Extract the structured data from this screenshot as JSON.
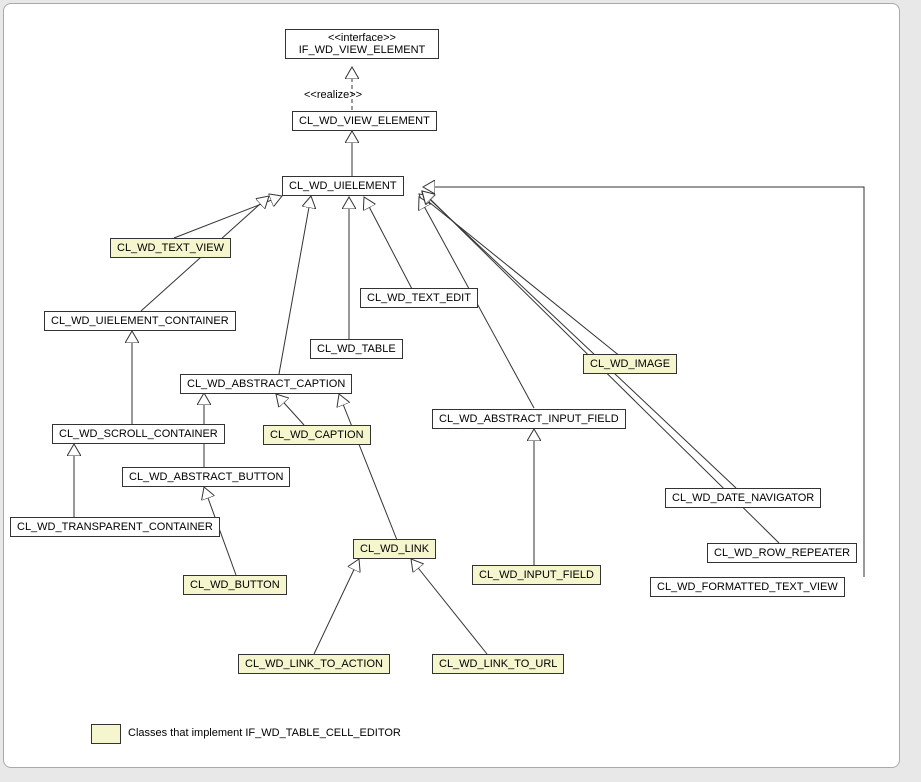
{
  "stereotypes": {
    "interface": "<<interface>>",
    "realize": "<<realize>>"
  },
  "nodes": {
    "if_view_element": "IF_WD_VIEW_ELEMENT",
    "view_element": "CL_WD_VIEW_ELEMENT",
    "uielement": "CL_WD_UIELEMENT",
    "text_view": "CL_WD_TEXT_VIEW",
    "text_edit": "CL_WD_TEXT_EDIT",
    "uielement_container": "CL_WD_UIELEMENT_CONTAINER",
    "table": "CL_WD_TABLE",
    "image": "CL_WD_IMAGE",
    "abstract_caption": "CL_WD_ABSTRACT_CAPTION",
    "abstract_input_field": "CL_WD_ABSTRACT_INPUT_FIELD",
    "scroll_container": "CL_WD_SCROLL_CONTAINER",
    "caption": "CL_WD_CAPTION",
    "date_navigator": "CL_WD_DATE_NAVIGATOR",
    "abstract_button": "CL_WD_ABSTRACT_BUTTON",
    "row_repeater": "CL_WD_ROW_REPEATER",
    "transparent_container": "CL_WD_TRANSPARENT_CONTAINER",
    "link": "CL_WD_LINK",
    "input_field": "CL_WD_INPUT_FIELD",
    "formatted_text_view": "CL_WD_FORMATTED_TEXT_VIEW",
    "button": "CL_WD_BUTTON",
    "link_to_action": "CL_WD_LINK_TO_ACTION",
    "link_to_url": "CL_WD_LINK_TO_URL"
  },
  "legend": {
    "text": "Classes that implement IF_WD_TABLE_CELL_EDITOR"
  }
}
